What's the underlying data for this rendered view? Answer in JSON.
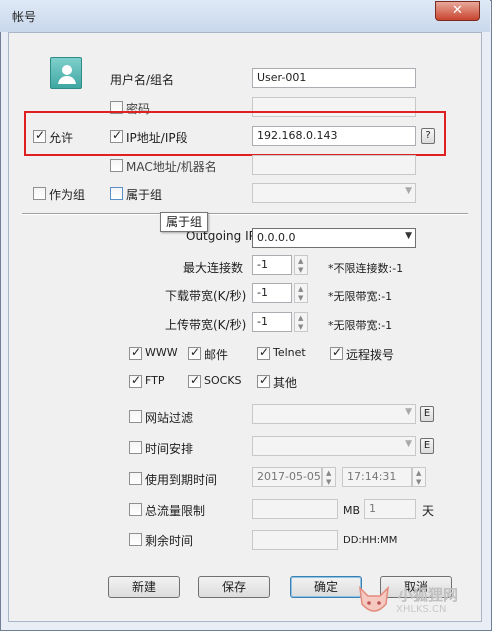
{
  "window": {
    "title": "帐号",
    "close_glyph": "✕"
  },
  "account": {
    "user_label": "用户名/组名",
    "user_value": "User-001",
    "password_label": "密码",
    "allow_label": "允许",
    "ip_label": "IP地址/IP段",
    "ip_value": "192.168.0.143",
    "help_glyph": "?",
    "mac_label": "MAC地址/机器名",
    "as_group_label": "作为组",
    "belongs_group_label": "属于组",
    "tooltip": "属于组"
  },
  "network": {
    "outgoing_label": "Outgoing IP",
    "outgoing_value": "0.0.0.0",
    "max_conn_label": "最大连接数",
    "max_conn_value": "-1",
    "max_conn_note": "*不限连接数:-1",
    "down_label": "下载带宽(K/秒)",
    "down_value": "-1",
    "down_note": "*无限带宽:-1",
    "up_label": "上传带宽(K/秒)",
    "up_value": "-1",
    "up_note": "*无限带宽:-1"
  },
  "protocols": {
    "www": "WWW",
    "mail": "邮件",
    "telnet": "Telnet",
    "remote": "远程拨号",
    "ftp": "FTP",
    "socks": "SOCKS",
    "other": "其他"
  },
  "limits": {
    "site_filter_label": "网站过滤",
    "schedule_label": "时间安排",
    "edit_glyph": "E",
    "expire_label": "使用到期时间",
    "expire_date": "2017-05-05",
    "expire_time": "17:14:31",
    "traffic_label": "总流量限制",
    "traffic_unit": "MB",
    "traffic_days": "1",
    "days_unit": "天",
    "remain_label": "剩余时间",
    "remain_format": "DD:HH:MM"
  },
  "buttons": {
    "new": "新建",
    "save": "保存",
    "ok": "确定",
    "cancel": "取消"
  },
  "watermark": {
    "text": "小狐狸网",
    "url": "XHLKS.CN"
  }
}
